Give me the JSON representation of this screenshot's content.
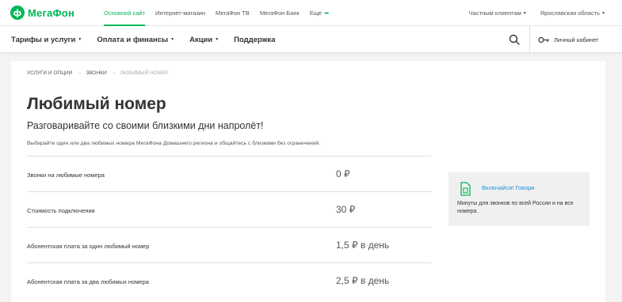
{
  "brand": {
    "name": "МегаФон",
    "color": "#00b956"
  },
  "top_nav": {
    "links": [
      "Основной сайт",
      "Интернет-магазин",
      "МегаФон ТВ",
      "МегаФон Банк",
      "Еще"
    ],
    "more_dots": "•••",
    "client_type": "Частным клиентам",
    "region": "Ярославская область"
  },
  "main_nav": {
    "items": [
      "Тарифы и услуги",
      "Оплата и финансы",
      "Акции",
      "Поддержка"
    ],
    "search_icon": "search-icon",
    "account_label": "Личный кабинет"
  },
  "breadcrumb": [
    "УСЛУГИ И ОПЦИИ",
    "ЗВОНКИ",
    "ЛЮБИМЫЙ НОМЕР"
  ],
  "page": {
    "title": "Любимый номер",
    "subtitle": "Разговаривайте со своими близкими дни напролёт!",
    "description": "Выбирайте один или два любимых номера МегаФона Домашнего региона и общайтесь с близкими без ограничений."
  },
  "pricing": [
    {
      "label": "Звонки на любимые номера",
      "value": "0 ₽"
    },
    {
      "label": "Стоимость подключения",
      "value": "30 ₽"
    },
    {
      "label": "Абонентская плата за один любимый номер",
      "value": "1,5 ₽ в день"
    },
    {
      "label": "Абонентская плата за два любимых номера",
      "value": "2,5 ₽ в день"
    }
  ],
  "promo": {
    "link": "Включайся! Говори",
    "text": "Минуты для звонков по всей России и на все номера.",
    "icon": "sim-card-icon"
  }
}
